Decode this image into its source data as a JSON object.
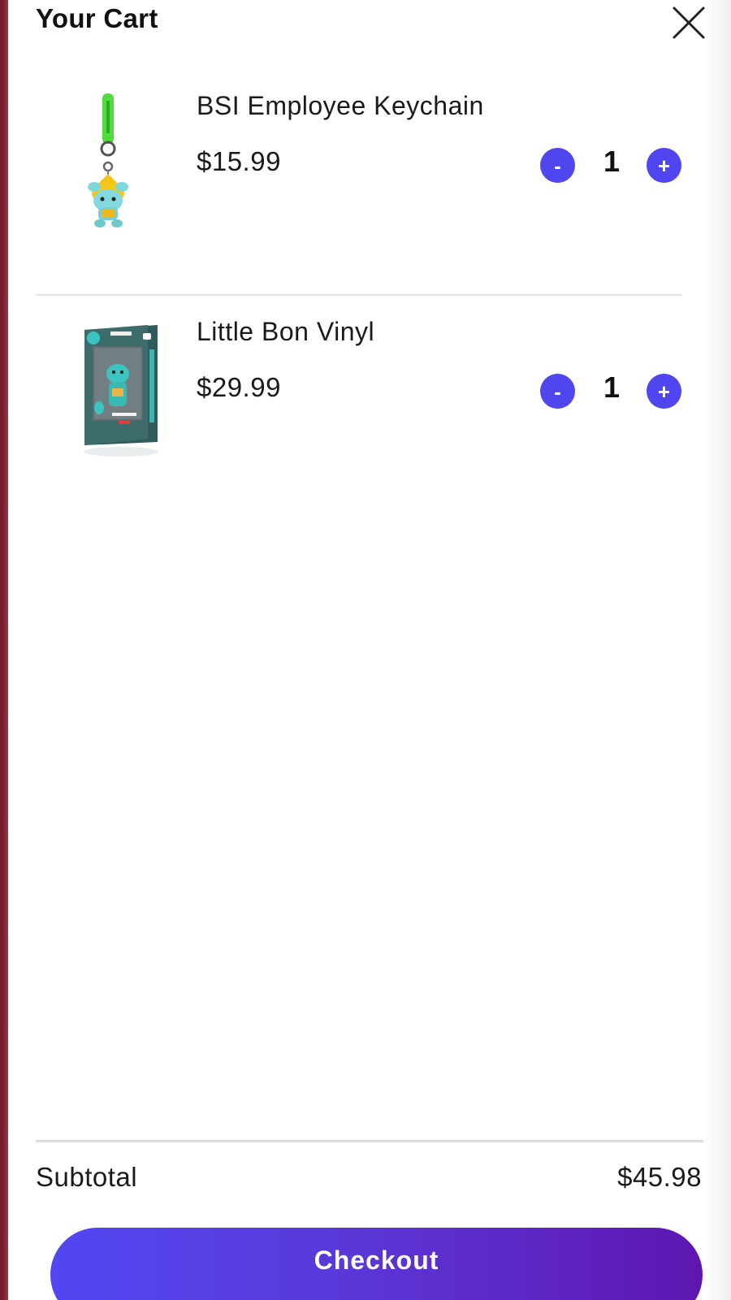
{
  "cart": {
    "title": "Your Cart",
    "close_icon": "close-icon"
  },
  "items": [
    {
      "name": "BSI Employee Keychain",
      "price": "$15.99",
      "quantity": "1",
      "decrement_label": "-",
      "increment_label": "+",
      "image": "keychain-thumbnail"
    },
    {
      "name": "Little Bon Vinyl",
      "price": "$29.99",
      "quantity": "1",
      "decrement_label": "-",
      "increment_label": "+",
      "image": "vinyl-box-thumbnail"
    }
  ],
  "summary": {
    "subtotal_label": "Subtotal",
    "subtotal_value": "$45.98"
  },
  "checkout": {
    "label": "Checkout"
  },
  "colors": {
    "accent": "#5046f0",
    "checkout_gradient_start": "#5247f2",
    "checkout_gradient_end": "#5f16b0",
    "left_strip": "#8a2334"
  }
}
